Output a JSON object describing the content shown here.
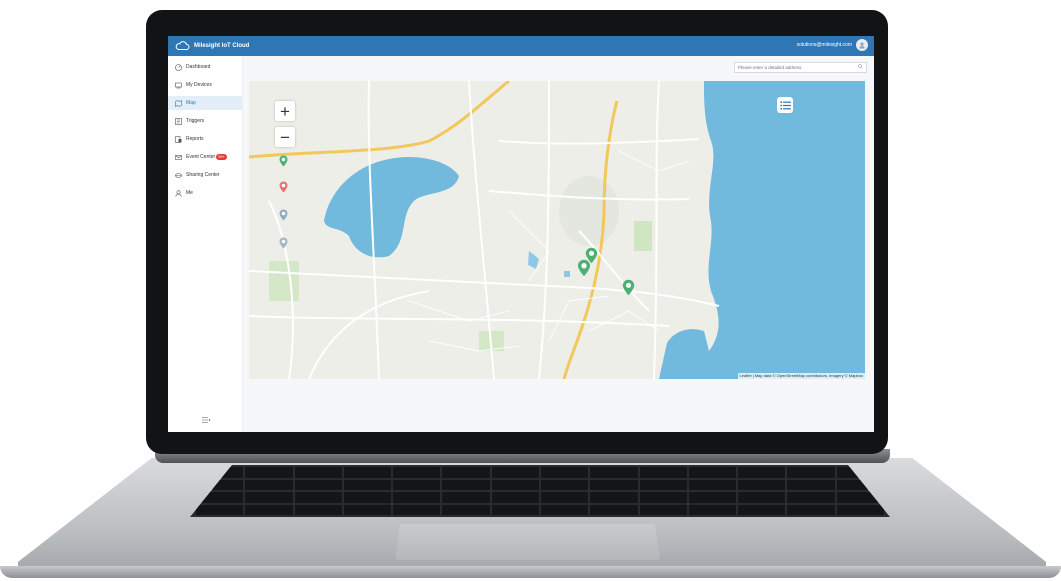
{
  "app": {
    "title": "Milesight IoT Cloud",
    "account_email": "solutions@milesight.com"
  },
  "sidebar": {
    "items": [
      {
        "label": "Dashboard",
        "icon": "dashboard-icon",
        "active": false
      },
      {
        "label": "My Devices",
        "icon": "devices-icon",
        "active": false
      },
      {
        "label": "Map",
        "icon": "map-icon",
        "active": true
      },
      {
        "label": "Triggers",
        "icon": "triggers-icon",
        "active": false
      },
      {
        "label": "Reports",
        "icon": "reports-icon",
        "active": false
      },
      {
        "label": "Event Center",
        "icon": "bell-icon",
        "active": false,
        "badge": "99+"
      },
      {
        "label": "Sharing Center",
        "icon": "share-icon",
        "active": false
      },
      {
        "label": "Me",
        "icon": "user-icon",
        "active": false
      }
    ]
  },
  "search": {
    "placeholder": "Please enter a detailed address."
  },
  "map": {
    "zoom_in": "+",
    "zoom_out": "−",
    "attribution": "Leaflet | Map data © OpenStreetMap contributors, Imagery © Mapbox"
  },
  "colors": {
    "topbar": "#2e77b4",
    "active_nav": "#e4eef8",
    "water": "#71b9dd",
    "pin_green": "#4caf76",
    "pin_red": "#e57373",
    "pin_blue": "#90a9c8",
    "badge": "#e53935"
  }
}
